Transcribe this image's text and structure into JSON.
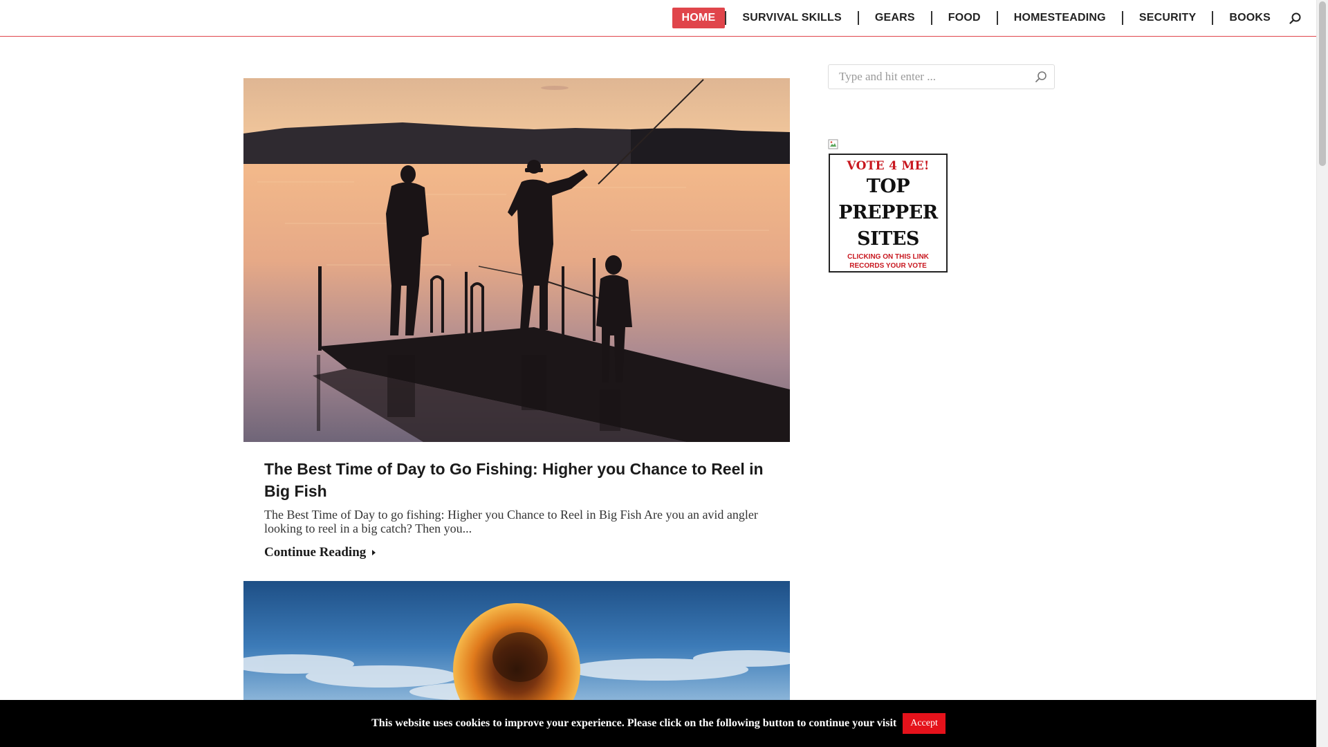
{
  "nav": {
    "items": [
      {
        "label": "HOME",
        "active": true
      },
      {
        "label": "SURVIVAL SKILLS"
      },
      {
        "label": "GEARS"
      },
      {
        "label": "FOOD"
      },
      {
        "label": "HOMESTEADING"
      },
      {
        "label": "SECURITY"
      },
      {
        "label": "BOOKS"
      }
    ],
    "search_icon": "search-icon"
  },
  "post": {
    "title": "The Best Time of Day to Go Fishing: Higher you Chance to Reel in Big Fish",
    "excerpt": "The Best Time of Day to go fishing: Higher you Chance to Reel in Big Fish Are you an avid angler looking to reel in a big catch? Then you...",
    "continue_label": "Continue Reading"
  },
  "sidebar": {
    "search_placeholder": "Type and hit enter ...",
    "vote": {
      "top": "VOTE 4 ME!",
      "line1": "TOP",
      "line2": "PREPPER",
      "line3": "SITES",
      "small1": "CLICKING ON THIS LINK",
      "small2": "RECORDS YOUR VOTE"
    }
  },
  "cookie": {
    "text": "This website uses cookies to improve your experience. Please click on the following button to continue your visit",
    "accept_label": "Accept"
  },
  "colors": {
    "accent": "#e0454b",
    "accept": "#e5121b",
    "cookie_bg": "#000000"
  }
}
